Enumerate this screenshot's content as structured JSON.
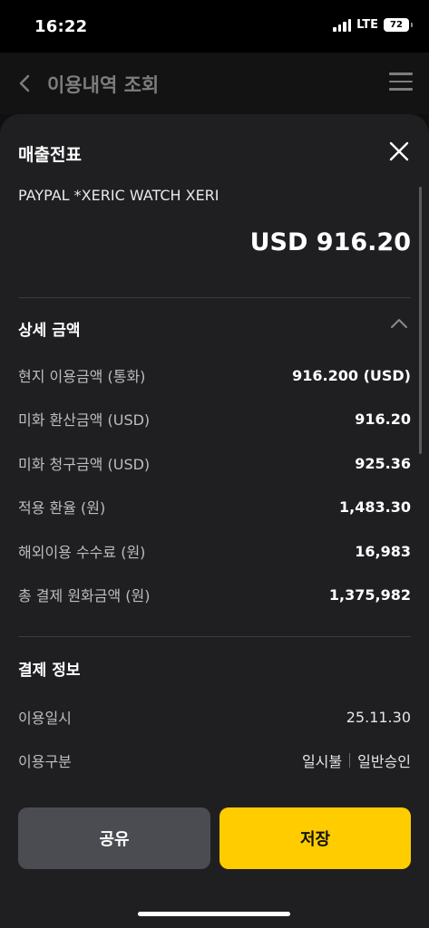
{
  "status_bar": {
    "time": "16:22",
    "network": "LTE",
    "battery": "72"
  },
  "nav": {
    "title": "이용내역 조회",
    "back_icon": "chevron-left-icon",
    "menu_icon": "hamburger-menu-icon"
  },
  "sheet": {
    "title": "매출전표",
    "merchant": "PAYPAL *XERIC WATCH XERI",
    "total_amount": "USD 916.20"
  },
  "details": {
    "section_title": "상세 금액",
    "rows": [
      {
        "label": "현지 이용금액 (통화)",
        "value": "916.200 (USD)"
      },
      {
        "label": "미화 환산금액 (USD)",
        "value": "916.20"
      },
      {
        "label": "미화 청구금액 (USD)",
        "value": "925.36"
      },
      {
        "label": "적용 환율 (원)",
        "value": "1,483.30"
      },
      {
        "label": "해외이용 수수료 (원)",
        "value": "16,983"
      },
      {
        "label": "총 결제 원화금액 (원)",
        "value": "1,375,982"
      }
    ]
  },
  "payment": {
    "section_title": "결제 정보",
    "date_label": "이용일시",
    "date_value": "25.11.30",
    "type_label": "이용구분",
    "type_value_1": "일시불",
    "type_value_2": "일반승인"
  },
  "buttons": {
    "share": "공유",
    "save": "저장"
  },
  "colors": {
    "accent": "#ffcc00",
    "sheet_bg": "#1f1f21",
    "secondary_button": "#4a4c52"
  }
}
